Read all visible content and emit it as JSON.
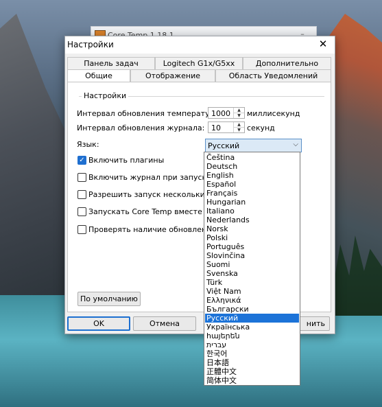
{
  "background_window": {
    "title": "Core Temp 1.18.1"
  },
  "dialog": {
    "title": "Настройки",
    "tabs_back": [
      "Панель задач Windows",
      "Logitech G1x/G5xx",
      "Дополнительно"
    ],
    "tabs_front": [
      "Общие",
      "Отображение",
      "Область Уведомлений"
    ],
    "active_tab": "Общие",
    "group_label": "Настройки",
    "temp_interval_label": "Интервал обновления температур:",
    "temp_interval_value": "1000",
    "temp_interval_unit": "миллисекунд",
    "log_interval_label": "Интервал обновления журнала:",
    "log_interval_value": "10",
    "log_interval_unit": "секунд",
    "language_label": "Язык:",
    "language_selected": "Русский",
    "checkboxes": [
      {
        "label": "Включить плагины",
        "checked": true
      },
      {
        "label": "Включить журнал при запуске",
        "checked": false
      },
      {
        "label": "Разрешить запуск нескольких ко",
        "checked": false
      },
      {
        "label": "Запускать Core Temp вместе с Wi",
        "checked": false
      },
      {
        "label": "Проверять наличие обновлений п",
        "checked": false
      }
    ],
    "defaults_button": "По умолчанию",
    "ok_button": "OK",
    "cancel_button": "Отмена",
    "apply_button": "нить"
  },
  "language_options": [
    "Čeština",
    "Deutsch",
    "English",
    "Español",
    "Français",
    "Hungarian",
    "Italiano",
    "Nederlands",
    "Norsk",
    "Polski",
    "Português",
    "Slovinčina",
    "Suomi",
    "Svenska",
    "Türk",
    "Việt Nam",
    "Ελληνικά",
    "Български",
    "Русский",
    "Українська",
    "հայերեն",
    "עברית",
    "한국어",
    "日本語",
    "正體中文",
    "简体中文"
  ],
  "colors": {
    "accent": "#1c73d8",
    "selection": "#1c73d8",
    "dialog_bg": "#f0f0f0"
  }
}
